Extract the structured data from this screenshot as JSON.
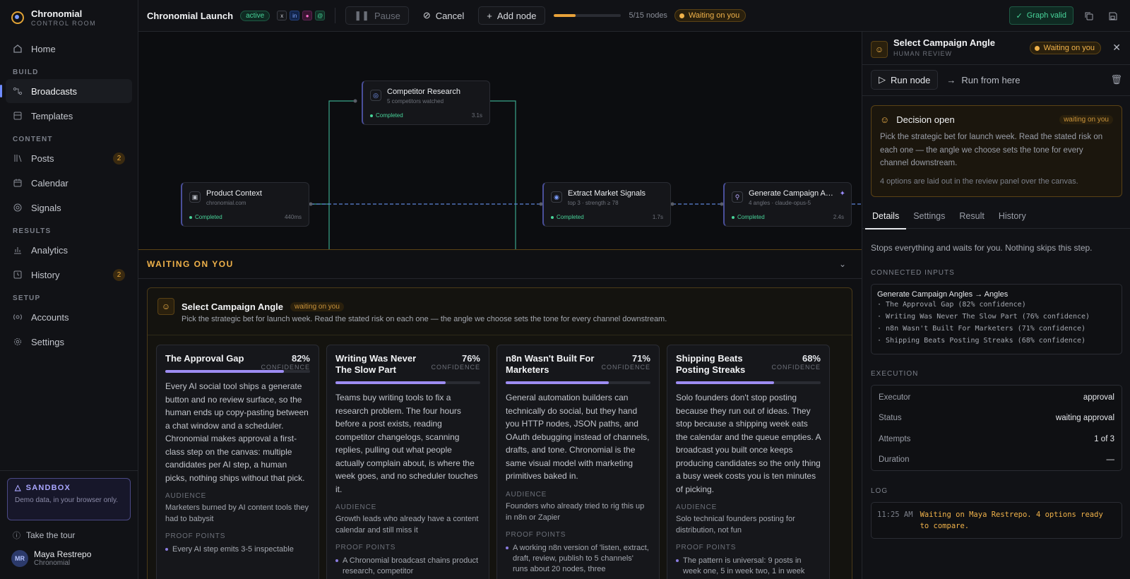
{
  "brand": {
    "name": "Chronomial",
    "sub": "CONTROL ROOM"
  },
  "sidebar": {
    "home": "Home",
    "sections": {
      "build": "BUILD",
      "content": "CONTENT",
      "results": "RESULTS",
      "setup": "SETUP"
    },
    "items": [
      {
        "label": "Broadcasts",
        "icon": "broadcast-icon"
      },
      {
        "label": "Templates",
        "icon": "templates-icon"
      },
      {
        "label": "Posts",
        "icon": "posts-icon",
        "badge": "2"
      },
      {
        "label": "Calendar",
        "icon": "calendar-icon"
      },
      {
        "label": "Signals",
        "icon": "signals-icon"
      },
      {
        "label": "Analytics",
        "icon": "analytics-icon"
      },
      {
        "label": "History",
        "icon": "history-icon",
        "badge": "2"
      },
      {
        "label": "Accounts",
        "icon": "accounts-icon"
      },
      {
        "label": "Settings",
        "icon": "settings-icon"
      }
    ],
    "sandbox": {
      "title": "SANDBOX",
      "text": "Demo data, in your browser only."
    },
    "tour": "Take the tour",
    "user": {
      "initials": "MR",
      "name": "Maya Restrepo",
      "org": "Chronomial"
    }
  },
  "topbar": {
    "title": "Chronomial Launch",
    "status": "active",
    "channels": [
      "x",
      "in",
      "ig",
      "@"
    ],
    "pause": "Pause",
    "cancel": "Cancel",
    "add_node": "Add node",
    "progress_fraction": 0.33,
    "progress_label": "5/15 nodes",
    "waiting": "Waiting on you",
    "graph_valid": "Graph valid"
  },
  "nodes": {
    "competitor": {
      "title": "Competitor Research",
      "sub": "5 competitors watched",
      "status": "Completed",
      "time": "3.1s"
    },
    "product": {
      "title": "Product Context",
      "sub": "chronomial.com",
      "status": "Completed",
      "time": "440ms"
    },
    "extract": {
      "title": "Extract Market Signals",
      "sub": "top 3 · strength ≥ 78",
      "status": "Completed",
      "time": "1.7s"
    },
    "generate": {
      "title": "Generate Campaign Angles",
      "sub": "4 angles · claude-opus-5",
      "status": "Completed",
      "time": "2.4s"
    }
  },
  "waiting_panel": {
    "title": "WAITING ON YOU",
    "decision": {
      "title": "Select Campaign Angle",
      "pill": "waiting on you",
      "text": "Pick the strategic bet for launch week. Read the stated risk on each one — the angle we choose sets the tone for every channel downstream."
    },
    "conf_label": "CONFIDENCE",
    "audience_label": "AUDIENCE",
    "proof_label": "PROOF POINTS",
    "cards": [
      {
        "title": "The Approval Gap",
        "pct": "82%",
        "confidence": 0.82,
        "body": "Every AI social tool ships a generate button and no review surface, so the human ends up copy-pasting between a chat window and a scheduler. Chronomial makes approval a first-class step on the canvas: multiple candidates per AI step, a human picks, nothing ships without that pick.",
        "audience": "Marketers burned by AI content tools they had to babysit",
        "proof": "Every AI step emits 3-5 inspectable"
      },
      {
        "title": "Writing Was Never The Slow Part",
        "pct": "76%",
        "confidence": 0.76,
        "body": "Teams buy writing tools to fix a research problem. The four hours before a post exists, reading competitor changelogs, scanning replies, pulling out what people actually complain about, is where the week goes, and no scheduler touches it.",
        "audience": "Growth leads who already have a content calendar and still miss it",
        "proof": "A Chronomial broadcast chains product research, competitor"
      },
      {
        "title": "n8n Wasn't Built For Marketers",
        "pct": "71%",
        "confidence": 0.71,
        "body": "General automation builders can technically do social, but they hand you HTTP nodes, JSON paths, and OAuth debugging instead of channels, drafts, and tone. Chronomial is the same visual model with marketing primitives baked in.",
        "audience": "Founders who already tried to rig this up in n8n or Zapier",
        "proof": "A working n8n version of 'listen, extract, draft, review, publish to 5 channels' runs about 20 nodes, three"
      },
      {
        "title": "Shipping Beats Posting Streaks",
        "pct": "68%",
        "confidence": 0.68,
        "body": "Solo founders don't stop posting because they run out of ideas. They stop because a shipping week eats the calendar and the queue empties. A broadcast you built once keeps producing candidates so the only thing a busy week costs you is ten minutes of picking.",
        "audience": "Solo technical founders posting for distribution, not fun",
        "proof": "The pattern is universal: 9 posts in week one, 5 in week two, 1 in week"
      }
    ]
  },
  "right_panel": {
    "title": "Select Campaign Angle",
    "sub": "HUMAN REVIEW",
    "status": "Waiting on you",
    "run_node": "Run node",
    "run_from": "Run from here",
    "open": {
      "title": "Decision open",
      "pill": "waiting on you",
      "text": "Pick the strategic bet for launch week. Read the stated risk on each one — the angle we choose sets the tone for every channel downstream.",
      "note": "4 options are laid out in the review panel over the canvas."
    },
    "tabs": [
      "Details",
      "Settings",
      "Result",
      "History"
    ],
    "description": "Stops everything and waits for you. Nothing skips this step.",
    "connected_label": "CONNECTED INPUTS",
    "inputs_title": "Generate Campaign Angles → Angles",
    "inputs": [
      "· The Approval Gap (82% confidence)",
      "· Writing Was Never The Slow Part (76% confidence)",
      "· n8n Wasn't Built For Marketers (71% confidence)",
      "· Shipping Beats Posting Streaks (68% confidence)"
    ],
    "execution_label": "EXECUTION",
    "execution": [
      {
        "k": "Executor",
        "v": "approval"
      },
      {
        "k": "Status",
        "v": "waiting approval"
      },
      {
        "k": "Attempts",
        "v": "1 of 3"
      },
      {
        "k": "Duration",
        "v": "—"
      }
    ],
    "log_label": "LOG",
    "log": {
      "time": "11:25 AM",
      "msg": "Waiting on Maya Restrepo. 4 options ready to compare."
    }
  },
  "colors": {
    "accent": "#6f8cff",
    "waiting": "#f0b24a",
    "success": "#48d49a",
    "confidence": "#9d8cf2"
  }
}
